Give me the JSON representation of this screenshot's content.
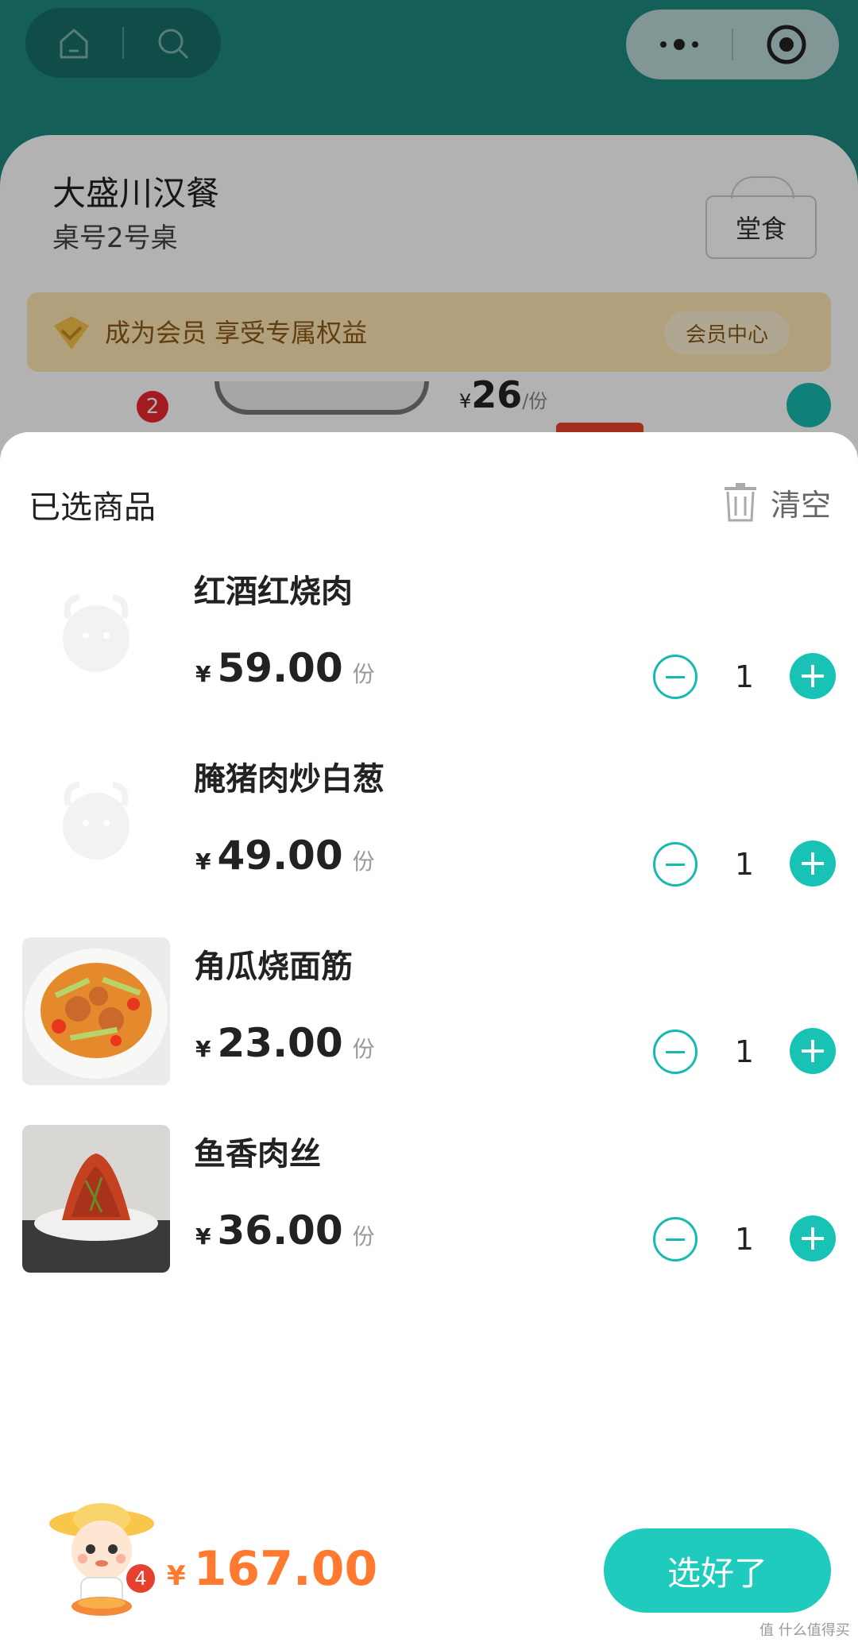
{
  "topbar": {
    "home_icon": "home-icon",
    "search_icon": "search-icon",
    "more_icon": "more-dots-icon",
    "close_icon": "target-close-icon"
  },
  "store": {
    "name": "大盛川汉餐",
    "table": "桌号2号桌",
    "dine_mode": "堂食",
    "member_banner": "成为会员 享受专属权益",
    "member_center": "会员中心",
    "bg_badge": "2",
    "bg_price": "26",
    "bg_price_currency": "¥",
    "bg_price_unit": "/份"
  },
  "cart": {
    "title": "已选商品",
    "clear_label": "清空",
    "currency": "¥",
    "unit": "份",
    "items": [
      {
        "name": "红酒红烧肉",
        "price": "59.00",
        "qty": "1"
      },
      {
        "name": "腌猪肉炒白葱",
        "price": "49.00",
        "qty": "1"
      },
      {
        "name": "角瓜烧面筋",
        "price": "23.00",
        "qty": "1"
      },
      {
        "name": "鱼香肉丝",
        "price": "36.00",
        "qty": "1"
      }
    ]
  },
  "footer": {
    "count": "4",
    "currency": "¥",
    "total": "167.00",
    "confirm": "选好了"
  },
  "watermark": "值 什么值得买",
  "colors": {
    "accent": "#1fcbbd",
    "header": "#1e8a80",
    "price_total": "#ff7a2f",
    "badge": "#e8402e"
  }
}
